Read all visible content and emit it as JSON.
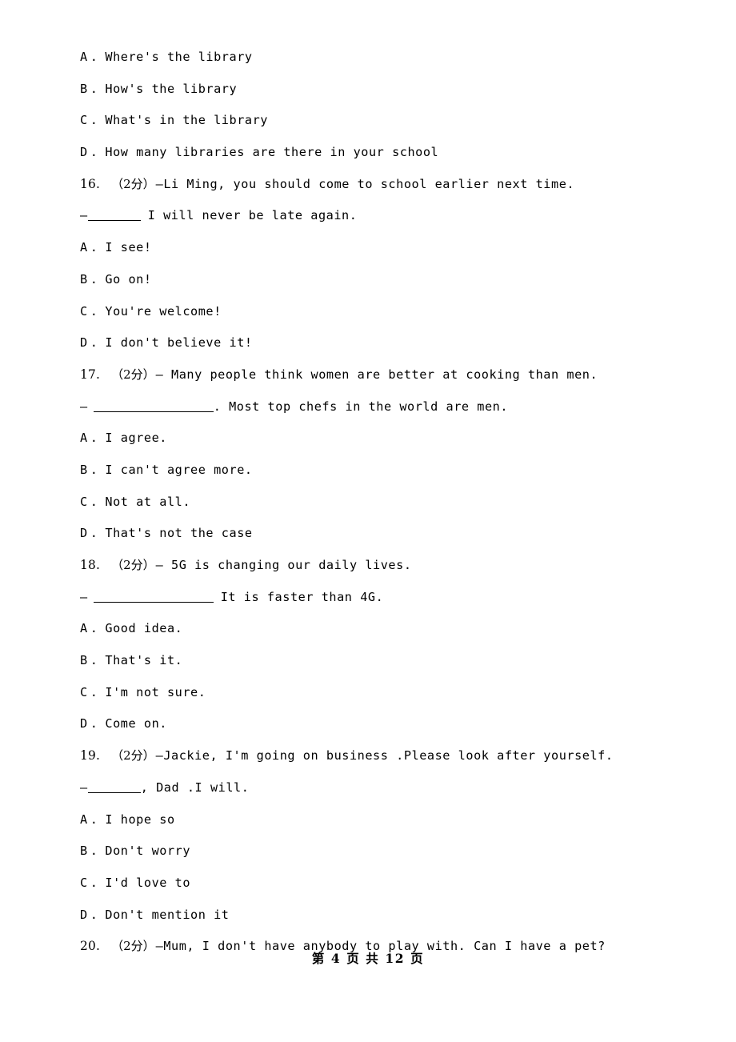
{
  "document": {
    "footer": "第 4 页 共 12 页",
    "marks_label": "（2分）"
  },
  "blocks": [
    {
      "kind": "orphan_options",
      "options": [
        {
          "letter": "A",
          "sep": ".",
          "text": "Where's the library"
        },
        {
          "letter": "B",
          "sep": ".",
          "text": "How's the library"
        },
        {
          "letter": "C",
          "sep": ".",
          "text": "What's in the library"
        },
        {
          "letter": "D",
          "sep": ".",
          "text": "How many libraries are there in your school"
        }
      ]
    },
    {
      "kind": "question",
      "number": "16.",
      "marks": "（2分）",
      "stem": "—Li Ming, you should come to school earlier next time.",
      "answer_dash": "—",
      "blank_style": "short",
      "blank_gap_before": false,
      "answer_text": "I will never be late again.",
      "answer_text_pad": true,
      "options": [
        {
          "letter": "A",
          "sep": ".",
          "text": "I see!"
        },
        {
          "letter": "B",
          "sep": ".",
          "text": "Go on!"
        },
        {
          "letter": "C",
          "sep": ".",
          "text": "You're welcome!"
        },
        {
          "letter": "D",
          "sep": ".",
          "text": "I don't believe it!"
        }
      ]
    },
    {
      "kind": "question",
      "number": "17.",
      "marks": "（2分）",
      "stem": "— Many people think women are better at cooking than men.",
      "answer_dash": "—",
      "blank_style": "long",
      "blank_gap_before": true,
      "answer_text": ". Most top chefs in the world are men.",
      "answer_text_pad": false,
      "options": [
        {
          "letter": "A",
          "sep": ".",
          "text": "I agree."
        },
        {
          "letter": "B",
          "sep": ".",
          "text": "I can't agree more."
        },
        {
          "letter": "C",
          "sep": ".",
          "text": "Not at all."
        },
        {
          "letter": "D",
          "sep": ".",
          "text": "That's not the case"
        }
      ]
    },
    {
      "kind": "question",
      "number": "18.",
      "marks": "（2分）",
      "stem": "— 5G is changing our daily lives.",
      "answer_dash": "—",
      "blank_style": "long",
      "blank_gap_before": true,
      "answer_text": "It is faster than 4G.",
      "answer_text_pad": true,
      "options": [
        {
          "letter": "A",
          "sep": ".",
          "text": "Good idea."
        },
        {
          "letter": "B",
          "sep": ".",
          "text": "That's it."
        },
        {
          "letter": "C",
          "sep": ".",
          "text": "I'm not sure."
        },
        {
          "letter": "D",
          "sep": ".",
          "text": "Come on."
        }
      ]
    },
    {
      "kind": "question",
      "number": "19.",
      "marks": "（2分）",
      "stem": "—Jackie, I'm going on business .Please look after yourself.",
      "answer_dash": "—",
      "blank_style": "short",
      "blank_gap_before": false,
      "answer_text": ", Dad .I will.",
      "answer_text_pad": false,
      "options": [
        {
          "letter": "A",
          "sep": ".",
          "text": "I hope so"
        },
        {
          "letter": "B",
          "sep": ".",
          "text": "Don't worry"
        },
        {
          "letter": "C",
          "sep": ".",
          "text": "I'd love to"
        },
        {
          "letter": "D",
          "sep": ".",
          "text": "Don't mention it"
        }
      ]
    },
    {
      "kind": "question_stem_only",
      "number": "20.",
      "marks": "（2分）",
      "stem": "—Mum, I don't have anybody to play with. Can I have a pet?"
    }
  ]
}
